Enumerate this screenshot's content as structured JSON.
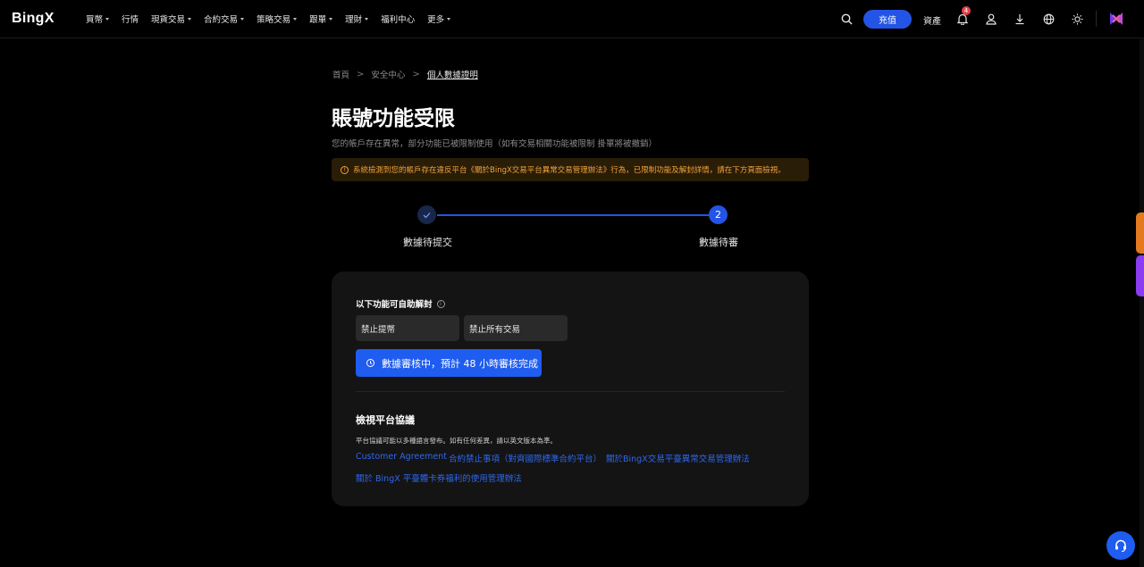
{
  "brand": {
    "logo": "BingX",
    "accent": "#2354e6",
    "warning_color": "#f0a23a"
  },
  "nav": {
    "menu": [
      {
        "label": "買幣",
        "has_caret": true
      },
      {
        "label": "行情",
        "has_caret": false
      },
      {
        "label": "現貨交易",
        "has_caret": true
      },
      {
        "label": "合約交易",
        "has_caret": true
      },
      {
        "label": "策略交易",
        "has_caret": true
      },
      {
        "label": "跟單",
        "has_caret": true
      },
      {
        "label": "理財",
        "has_caret": true
      },
      {
        "label": "福利中心",
        "has_caret": false
      },
      {
        "label": "更多",
        "has_caret": true
      }
    ],
    "deposit_label": "充值",
    "assets_label": "資產",
    "notification_count": "4",
    "icons": [
      "search-icon",
      "bell-icon",
      "user-icon",
      "download-icon",
      "globe-icon",
      "theme-icon",
      "avatar-icon"
    ]
  },
  "breadcrumb": {
    "home": "首頁",
    "security": "安全中心",
    "current": "個人數據證明",
    "sep": ">"
  },
  "page": {
    "title": "賬號功能受限",
    "subtitle": "您的帳戶存在異常，部分功能已被限制使用（如有交易相關功能被限制 掛單將被撤銷）",
    "warning": "系統檢測到您的帳戶存在違反平台《關於BingX交易平台異常交易管理辦法》行為，已限制功能及解封詳情，請在下方頁面檢視。"
  },
  "stepper": {
    "steps": [
      {
        "label": "數據待提交",
        "state": "done"
      },
      {
        "label": "數據待審",
        "state": "active",
        "number": "2"
      }
    ]
  },
  "card": {
    "self_unlock_heading": "以下功能可自助解封",
    "restrictions": [
      "禁止提幣",
      "禁止所有交易"
    ],
    "review_button": "數據審核中，預計 48 小時審核完成",
    "protocols_heading": "檢視平台協議",
    "protocols_note": "平台協議可能以多種語言發布。如有任何差異，請以英文版本為準。",
    "links": [
      "Customer Agreement",
      "合約禁止事項（對齊國際標準合約平台）",
      "關於BingX交易平臺異常交易管理辦法",
      "關於 BingX 平臺體卡券福利的使用管理辦法"
    ]
  }
}
